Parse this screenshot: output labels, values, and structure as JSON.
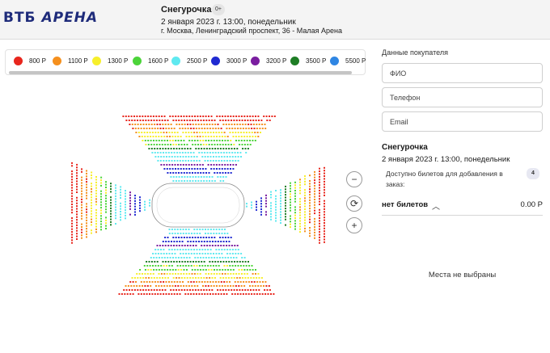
{
  "header": {
    "logo_main": "ВТБ",
    "logo_sub": "АРЕНА",
    "event_title": "Снегурочка",
    "age_rating": "0+",
    "event_date": "2 января 2023 г. 13:00, понедельник",
    "venue": "г. Москва, Ленинградский проспект, 36 - Малая Арена"
  },
  "legend": [
    {
      "label": "800 Р",
      "color": "#e8261d"
    },
    {
      "label": "1100 Р",
      "color": "#f5901e"
    },
    {
      "label": "1300 Р",
      "color": "#f7ef2b"
    },
    {
      "label": "1600 Р",
      "color": "#4cd43a"
    },
    {
      "label": "2500 Р",
      "color": "#5fe9f0"
    },
    {
      "label": "3000 Р",
      "color": "#1f2ad1"
    },
    {
      "label": "3200 Р",
      "color": "#7a1ea0"
    },
    {
      "label": "3500 Р",
      "color": "#1e7d25"
    },
    {
      "label": "5500 Р",
      "color": "#2f86e3"
    }
  ],
  "zoom": {
    "out": "−",
    "reset": "⟳",
    "in": "+"
  },
  "buyer": {
    "heading": "Данные покупателя",
    "name_placeholder": "ФИО",
    "phone_placeholder": "Телефон",
    "email_placeholder": "Email"
  },
  "order": {
    "event_title": "Снегурочка",
    "event_date": "2 января 2023 г. 13:00, понедельник",
    "available_text": "Доступно билетов для добавления в заказ:",
    "available_count": "4",
    "tickets_label": "нет билетов",
    "total": "0.00 Р",
    "empty_message": "Места не выбраны"
  }
}
